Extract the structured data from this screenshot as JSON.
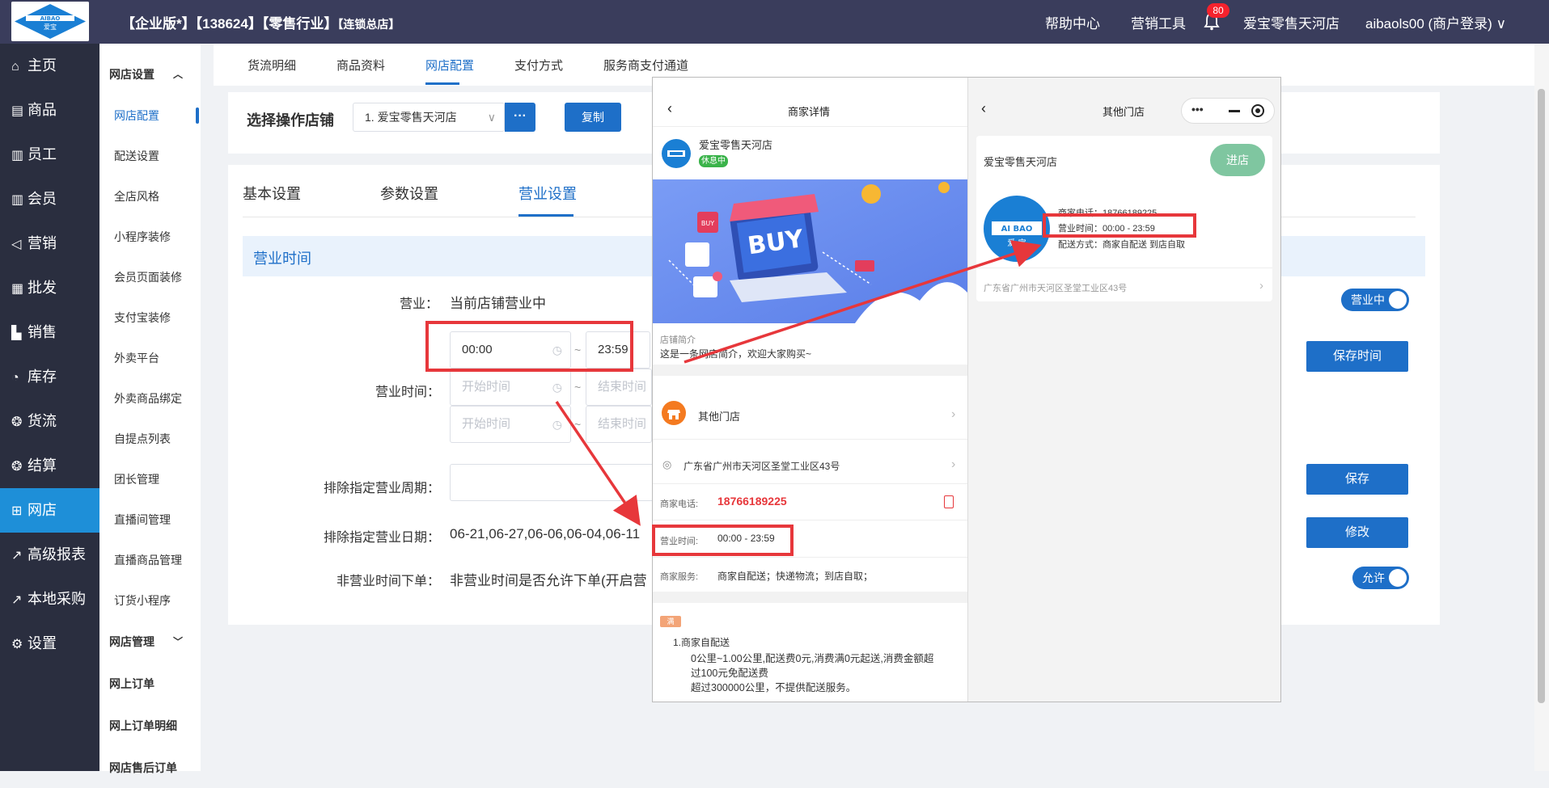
{
  "header": {
    "logo_text_top": "AIBAO",
    "logo_text_bottom": "爱宝",
    "info_main": "【企业版*】【138624】【零售行业】",
    "info_small": "【连锁总店】",
    "help": "帮助中心",
    "marketing_tools": "营销工具",
    "bell_badge": "80",
    "store_name": "爱宝零售天河店",
    "account": "aibaols00 (商户登录)"
  },
  "leftnav": [
    {
      "icon": "home-icon",
      "glyph": "⌂",
      "label": "主页"
    },
    {
      "icon": "goods-icon",
      "glyph": "▤",
      "label": "商品"
    },
    {
      "icon": "staff-icon",
      "glyph": "▥",
      "label": "员工"
    },
    {
      "icon": "member-icon",
      "glyph": "▥",
      "label": "会员"
    },
    {
      "icon": "megaphone-icon",
      "glyph": "◁",
      "label": "营销"
    },
    {
      "icon": "wholesale-icon",
      "glyph": "▦",
      "label": "批发"
    },
    {
      "icon": "sales-chart-icon",
      "glyph": "▙",
      "label": "销售"
    },
    {
      "icon": "inventory-icon",
      "glyph": "◔",
      "label": "库存"
    },
    {
      "icon": "logistics-icon",
      "glyph": "❂",
      "label": "货流"
    },
    {
      "icon": "settlement-icon",
      "glyph": "❂",
      "label": "结算"
    },
    {
      "icon": "gift-icon",
      "glyph": "⊞",
      "label": "网店"
    },
    {
      "icon": "report-icon",
      "glyph": "↗",
      "label": "高级报表"
    },
    {
      "icon": "purchase-icon",
      "glyph": "↗",
      "label": "本地采购"
    },
    {
      "icon": "gear-icon",
      "glyph": "⚙",
      "label": "设置"
    }
  ],
  "subnav": {
    "group1": "网店设置",
    "items": [
      "网店配置",
      "配送设置",
      "全店风格",
      "小程序装修",
      "会员页面装修",
      "支付宝装修",
      "外卖平台",
      "外卖商品绑定",
      "自提点列表",
      "团长管理",
      "直播间管理",
      "直播商品管理",
      "订货小程序"
    ],
    "group2": "网店管理",
    "group2_items": [
      "网上订单",
      "网上订单明细",
      "网店售后订单"
    ]
  },
  "tabs_top": [
    "货流明细",
    "商品资料",
    "网店配置",
    "支付方式",
    "服务商支付通道"
  ],
  "store_select": {
    "label": "选择操作店铺",
    "value": "1. 爱宝零售天河店",
    "more_button": "···",
    "copy_button": "复制"
  },
  "tabs_settings": [
    "基本设置",
    "参数设置",
    "营业设置"
  ],
  "section_title": "营业时间",
  "form": {
    "business_label": "营业：",
    "business_status": "当前店铺营业中",
    "hours_label": "营业时间：",
    "start1": "00:00",
    "end1": "23:59",
    "start_placeholder": "开始时间",
    "end_placeholder": "结束时间",
    "tilde": "~",
    "exclude_period_label": "排除指定营业周期：",
    "exclude_date_label": "排除指定营业日期：",
    "exclude_dates": "06-21,06-27,06-06,06-04,06-11",
    "nonbusiness_label": "非营业时间下单：",
    "nonbusiness_text": "非营业时间是否允许下单(开启营"
  },
  "right_controls": {
    "status_toggle": "营业中",
    "save_time": "保存时间",
    "save": "保存",
    "modify": "修改",
    "allow_toggle": "允许"
  },
  "phone_left": {
    "title": "商家详情",
    "store_name": "爱宝零售天河店",
    "status_badge": "休息中",
    "banner_text": "BUY",
    "banner_tag": "BUY",
    "intro_label": "店铺简介",
    "intro_text": "这是一条网店简介，欢迎大家购买~",
    "other_stores": "其他门店",
    "address": "广东省广州市天河区圣堂工业区43号",
    "phone_label": "商家电话:",
    "phone_value": "18766189225",
    "hours_label": "营业时间:",
    "hours_value": "00:00 - 23:59",
    "service_label": "商家服务:",
    "service_value": "商家自配送；快递物流；到店自取；",
    "tag": "满",
    "delivery_title": "1.商家自配送",
    "delivery_line1": "0公里~1.00公里,配送费0元,消费满0元起送,消费金额超",
    "delivery_line2": "过100元免配送费",
    "delivery_line3": "超过300000公里，不提供配送服务。"
  },
  "phone_right": {
    "title": "其他门店",
    "store_name": "爱宝零售天河店",
    "enter_button": "进店",
    "phone_line": "商家电话：18766189225",
    "hours_line": "营业时间：00:00 - 23:59",
    "delivery_line": "配送方式：商家自配送  到店自取",
    "address": "广东省广州市天河区圣堂工业区43号",
    "logo_top": "AI BAO",
    "logo_bottom": "爱 宝"
  },
  "colors": {
    "primary": "#1e6fc8",
    "topbar": "#3a3d5c",
    "sidebar": "#2a2e3f",
    "highlight": "#e7373b",
    "enter_button": "#7fc6a0"
  }
}
